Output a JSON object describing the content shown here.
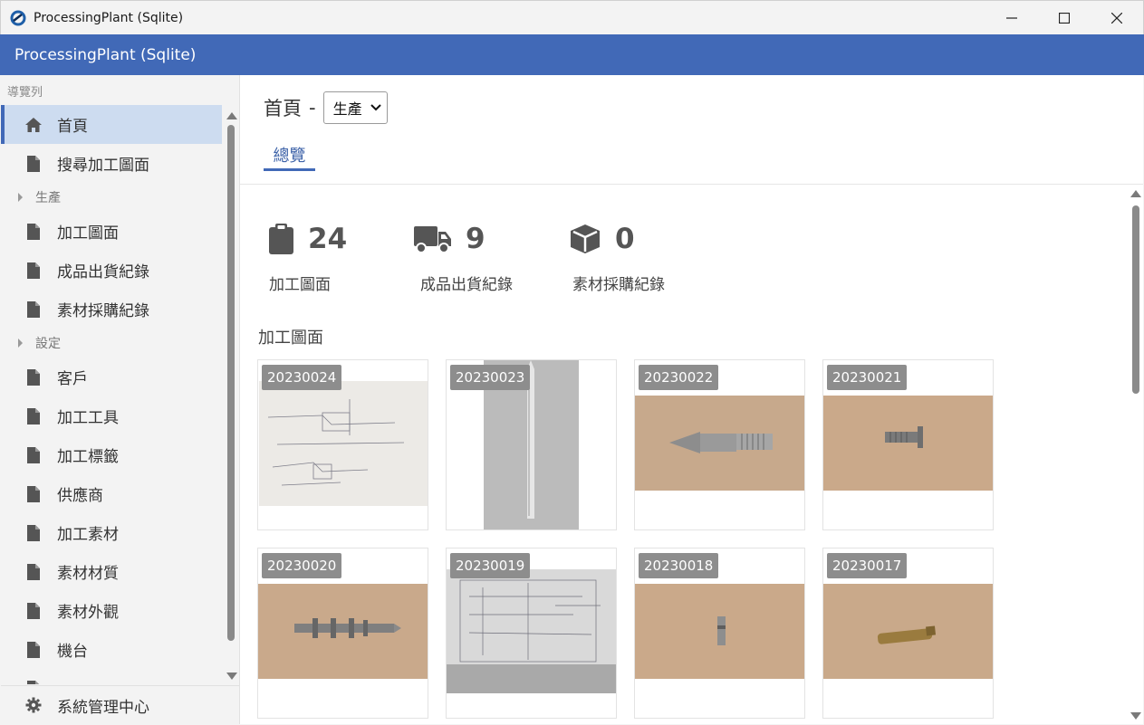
{
  "window": {
    "title": "ProcessingPlant (Sqlite)"
  },
  "app_header": {
    "title": "ProcessingPlant (Sqlite)"
  },
  "sidebar": {
    "caption": "導覽列",
    "home": "首頁",
    "search_drawings": "搜尋加工圖面",
    "group_production": "生產",
    "drawings": "加工圖面",
    "shipments": "成品出貨紀錄",
    "purchases": "素材採購紀錄",
    "group_settings": "設定",
    "customers": "客戶",
    "tools": "加工工具",
    "tags": "加工標籤",
    "suppliers": "供應商",
    "materials": "加工素材",
    "material_quality": "素材材質",
    "material_appearance": "素材外觀",
    "machines": "機台",
    "system_center": "系統管理中心"
  },
  "page": {
    "title": "首頁",
    "separator": "-",
    "selector_value": "生產",
    "tab_overview": "總覽"
  },
  "stats": [
    {
      "icon": "clipboard-icon",
      "value": "24",
      "label": "加工圖面"
    },
    {
      "icon": "truck-icon",
      "value": "9",
      "label": "成品出貨紀錄"
    },
    {
      "icon": "box-icon",
      "value": "0",
      "label": "素材採購紀錄"
    }
  ],
  "drawings_section": {
    "title": "加工圖面",
    "cards": [
      "20230024",
      "20230023",
      "20230022",
      "20230021",
      "20230020",
      "20230019",
      "20230018",
      "20230017"
    ]
  },
  "colors": {
    "accent": "#4169b7",
    "active_nav": "#cddcf0"
  }
}
